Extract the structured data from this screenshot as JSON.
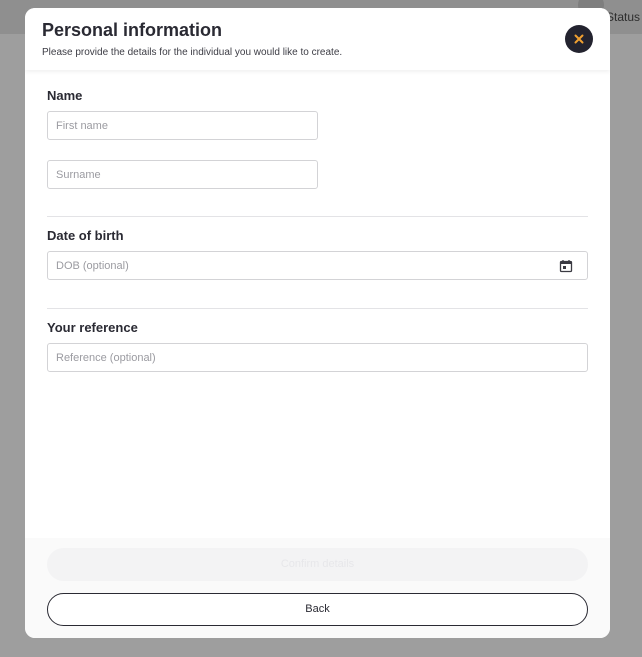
{
  "background": {
    "status_label": "Status"
  },
  "modal": {
    "title": "Personal information",
    "subtitle": "Please provide the details for the individual you would like to create.",
    "close_icon": "close-icon",
    "colors": {
      "close_button_bg": "#23232f",
      "close_icon": "#f0a030",
      "text_primary": "#2a2a33"
    }
  },
  "form": {
    "name_section": {
      "label": "Name",
      "first_name_placeholder": "First name",
      "first_name_value": "",
      "surname_placeholder": "Surname",
      "surname_value": ""
    },
    "dob_section": {
      "label": "Date of birth",
      "dob_placeholder": "DOB (optional)",
      "dob_value": "",
      "calendar_icon": "calendar-icon"
    },
    "reference_section": {
      "label": "Your reference",
      "reference_placeholder": "Reference (optional)",
      "reference_value": ""
    }
  },
  "footer": {
    "confirm_label": "Confirm details",
    "back_label": "Back"
  }
}
